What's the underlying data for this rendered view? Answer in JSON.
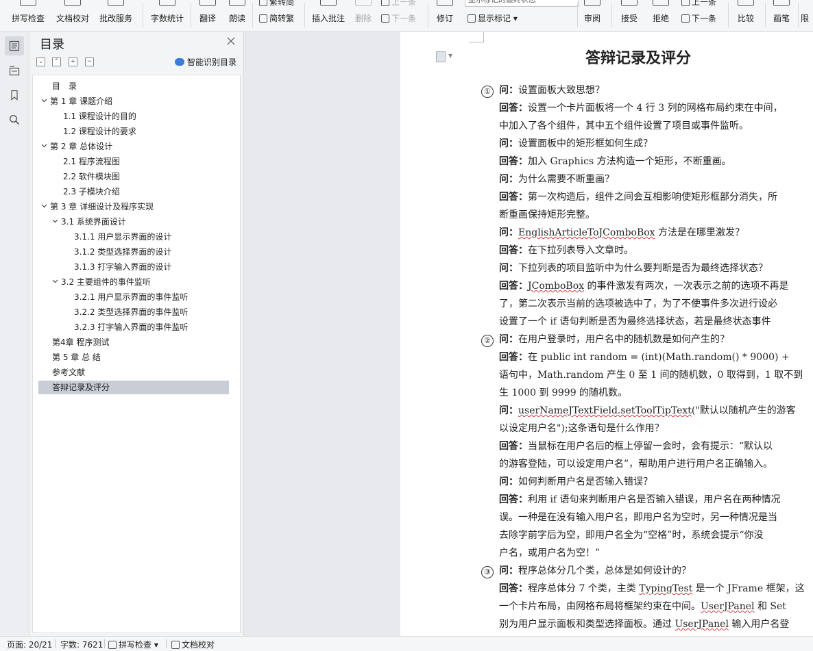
{
  "toolbar": {
    "spell_check": "拼写检查",
    "doc_proof": "文档校对",
    "batch_service": "批改服务",
    "word_count": "字数统计",
    "translate": "翻译",
    "read_aloud": "朗读",
    "to_traditional": "繁转简",
    "to_simplified": "简转繁",
    "insert_comment": "插入批注",
    "delete": "删除",
    "next_comment": "下一条",
    "prev_comment": "上一条",
    "revise": "修订",
    "track_display": "显示标记的最终状态",
    "show_markup": "显示标记",
    "review": "审阅",
    "accept": "接受",
    "reject": "拒绝",
    "prev_change": "上一条",
    "next_change": "下一条",
    "compare": "比较",
    "pen": "画笔",
    "limit": "限"
  },
  "nav": {
    "title": "目录",
    "smart_toc": "智能识别目录",
    "items": [
      {
        "text": "目　录"
      },
      {
        "text": "第 1 章  课题介绍"
      },
      {
        "text": "1.1  课程设计的目的"
      },
      {
        "text": "1.2  课程设计的要求"
      },
      {
        "text": "第 2 章  总体设计"
      },
      {
        "text": "2.1  程序流程图"
      },
      {
        "text": "2.2  软件模块图"
      },
      {
        "text": "2.3  子模块介绍"
      },
      {
        "text": "第 3 章  详细设计及程序实现"
      },
      {
        "text": "3.1  系统界面设计"
      },
      {
        "text": "3.1.1  用户显示界面的设计"
      },
      {
        "text": "3.1.2 类型选择界面的设计"
      },
      {
        "text": "3.1.3  打字输入界面的设计"
      },
      {
        "text": "3.2  主要组件的事件监听"
      },
      {
        "text": "3.2.1  用户显示界面的事件监听"
      },
      {
        "text": "3.2.2  类型选择界面的事件监听"
      },
      {
        "text": "3.2.3  打字输入界面的事件监听"
      },
      {
        "text": "第4章  程序测试"
      },
      {
        "text": "第 5 章  总    结"
      },
      {
        "text": "参考文献"
      },
      {
        "text": "答辩记录及评分"
      }
    ]
  },
  "document": {
    "title": "答辩记录及评分",
    "markers": [
      "①",
      "②",
      "③"
    ],
    "q_label": "问：",
    "a_label": "回答：",
    "lines": [
      "设置面板大致思想？",
      "设置一个卡片面板将一个 4 行 3 列的网格布局约束在中间，",
      "中加入了各个组件，其中五个组件设置了项目或事件监听。",
      "设置面板中的矩形框如何生成？",
      "加入 Graphics 方法构造一个矩形，不断重画。",
      "为什么需要不断重画？",
      "第一次构造后，组件之间会互相影响使矩形框部分消失，所",
      "断重画保持矩形完整。",
      "EnglishArticleToJComboBox",
      " 方法是在哪里激发？",
      "在下拉列表导入文章时。",
      "下拉列表的项目监听中为什么要判断是否为最终选择状态？",
      "JComboBox",
      " 的事件激发有两次，一次表示之前的选项不再是",
      "了，第二次表示当前的选项被选中了，为了不使事件多次进行设必",
      "设置了一个 if 语句判断是否为最终选择状态，若是最终状态事件",
      "在用户登录时，用户名中的随机数是如何产生的？",
      "在 public int random = (int)(Math.random() * 9000) +",
      "语句中，Math.random 产生 0 至 1 间的随机数，0 取得到，1 取不到",
      "生 1000 到 9999 的随机数。",
      "userNameJTextField.setToolTipText",
      "(\"默认以随机产生的游客",
      "以设定用户名\");这条语句是什么作用？",
      "当鼠标在用户名后的框上停留一会时，会有提示：“默认以",
      "的游客登陆，可以设定用户名”，帮助用户进行用户名正确输入。",
      "如何判断用户名是否输入错误？",
      "利用 if 语句来判断用户名是否输入错误，用户名在两种情况",
      "误。一种是在没有输入用户名，即用户名为空时，另一种情况是当",
      "去除字前字后为空，即用户名全为“空格”时，系统会提示“你没",
      "户名，或用户名为空！”",
      "程序总体分几个类，总体是如何设计的？",
      "程序总体分 7 个类，主类 ",
      "TypingTest",
      " 是一个 ",
      "JFrame",
      " 框架，这",
      "一个卡片布局，由网格布局将框架约束在中间。",
      "UserJPanel",
      " 和 Set",
      "别为用户显示面板和类型选择面板。通过 ",
      "UserJPanel",
      " 输入用户名登"
    ]
  },
  "status": {
    "page": "页面: 20/21",
    "words": "字数: 7621",
    "spell": "拼写检查",
    "proof": "文档校对"
  }
}
